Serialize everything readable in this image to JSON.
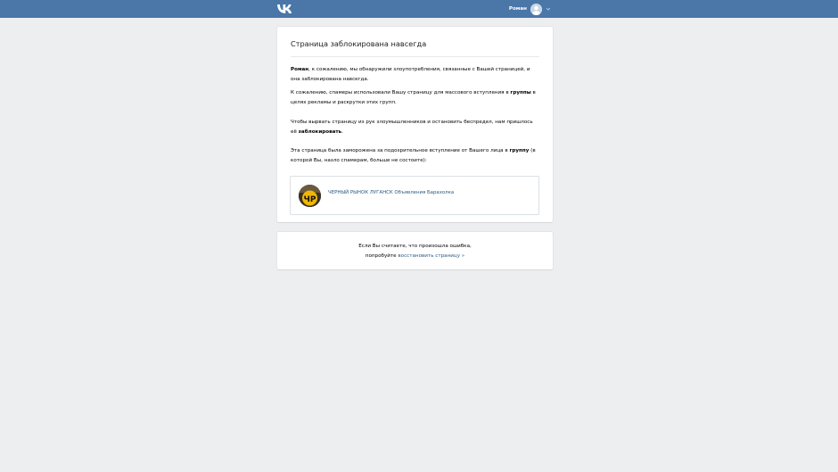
{
  "header": {
    "logo": "VK",
    "user_name": "Роман"
  },
  "block_card": {
    "title": "Страница заблокирована навсегда",
    "p1_name": "Роман",
    "p1_text": ", к сожалению, мы обнаружили злоупотребления, связанные с Вашей страницей, и она заблокирована навсегда.",
    "p2_pre": "К сожалению, спамеры использовали Вашу страницу для массового вступления в ",
    "p2_bold": "группы",
    "p2_post": " в целях рекламы и раскрутки этих групп.",
    "p3_pre": "Чтобы вырвать страницу из рук злоумышленников и остановить беспредел, нам пришлось её ",
    "p3_bold": "заблокировать",
    "p3_post": ".",
    "p4_pre": "Эта страница была заморожена за подозрительное вступление от Вашего лица в ",
    "p4_bold": "группу",
    "p4_post": " (в которой Вы, назло спамерам, больше не состоите):",
    "group": {
      "avatar_text": "ЧР",
      "name": "ЧЕРНЫЙ РЫНОК ЛУГАНСК Объявления Барахолка"
    }
  },
  "restore_card": {
    "line1": "Если Вы считаете, что произошла ошибка,",
    "line2_pre": "попробуйте ",
    "link": "восстановить страницу »"
  }
}
